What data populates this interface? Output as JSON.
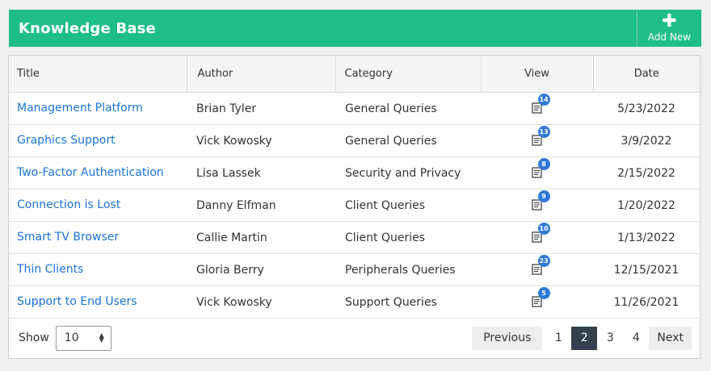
{
  "header": {
    "title": "Knowledge Base",
    "add_label": "Add New"
  },
  "table": {
    "columns": [
      "Title",
      "Author",
      "Category",
      "View",
      "Date"
    ],
    "rows": [
      {
        "title": "Management Platform",
        "author": "Brian Tyler",
        "category": "General Queries",
        "views": "14",
        "date": "5/23/2022"
      },
      {
        "title": "Graphics Support",
        "author": "Vick Kowosky",
        "category": "General Queries",
        "views": "13",
        "date": "3/9/2022"
      },
      {
        "title": "Two-Factor Authentication",
        "author": "Lisa Lassek",
        "category": "Security and Privacy",
        "views": "8",
        "date": "2/15/2022"
      },
      {
        "title": "Connection is Lost",
        "author": "Danny Elfman",
        "category": "Client Queries",
        "views": "9",
        "date": "1/20/2022"
      },
      {
        "title": "Smart TV Browser",
        "author": "Callie Martin",
        "category": "Client Queries",
        "views": "10",
        "date": "1/13/2022"
      },
      {
        "title": "Thin Clients",
        "author": "Gloria Berry",
        "category": "Peripherals Queries",
        "views": "23",
        "date": "12/15/2021"
      },
      {
        "title": "Support to End Users",
        "author": "Vick Kowosky",
        "category": "Support Queries",
        "views": "5",
        "date": "11/26/2021"
      }
    ]
  },
  "footer": {
    "show_label": "Show",
    "page_size": "10",
    "previous_label": "Previous",
    "next_label": "Next",
    "pages": [
      "1",
      "2",
      "3",
      "4"
    ],
    "current_page": "2"
  },
  "colors": {
    "accent": "#1fbe89",
    "link": "#1a73d9",
    "badge": "#2f7ad8",
    "active_page": "#34404b"
  }
}
